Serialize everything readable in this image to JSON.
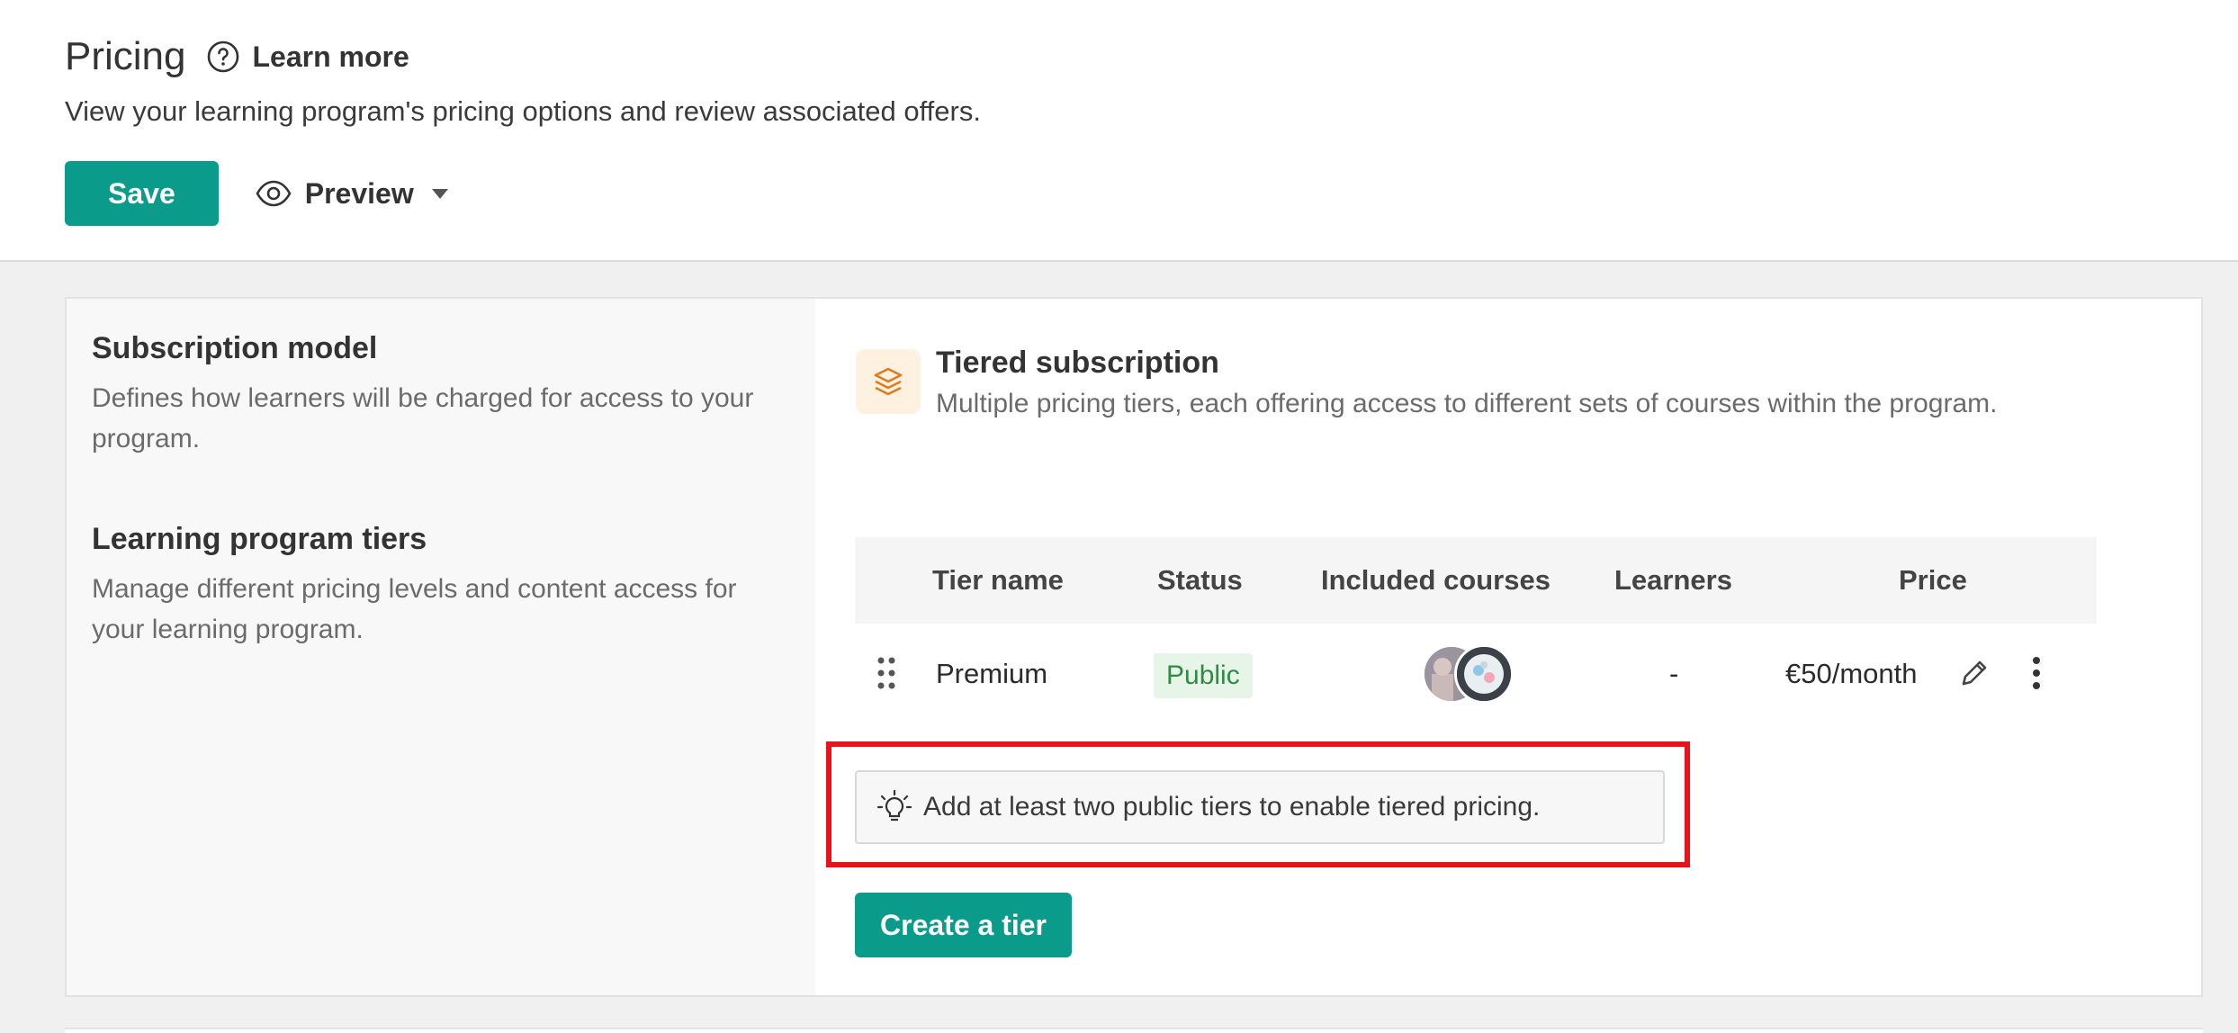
{
  "header": {
    "title": "Pricing",
    "learn_more": "Learn more",
    "subtitle": "View your learning program's pricing options and review associated offers.",
    "save_label": "Save",
    "preview_label": "Preview"
  },
  "left": {
    "subscription_title": "Subscription model",
    "subscription_desc": "Defines how learners will be charged for access to your program.",
    "tiers_title": "Learning program tiers",
    "tiers_desc": "Manage different pricing levels and content access for your learning program."
  },
  "subscription": {
    "title": "Tiered subscription",
    "description": "Multiple pricing tiers, each offering access to different sets of courses within the program.",
    "icon": "layers-icon"
  },
  "table": {
    "columns": [
      "Tier name",
      "Status",
      "Included courses",
      "Learners",
      "Price"
    ],
    "rows": [
      {
        "tier_name": "Premium",
        "status": "Public",
        "learners": "-",
        "price": "€50/month"
      }
    ]
  },
  "hint": {
    "text": "Add at least two public tiers to enable tiered pricing."
  },
  "create_tier_label": "Create a tier",
  "colors": {
    "accent": "#0a9b8a",
    "highlight": "#e8141c",
    "badge_bg": "#e7f5e9",
    "badge_text": "#2e8b43",
    "icon_bg": "#fff1df"
  }
}
